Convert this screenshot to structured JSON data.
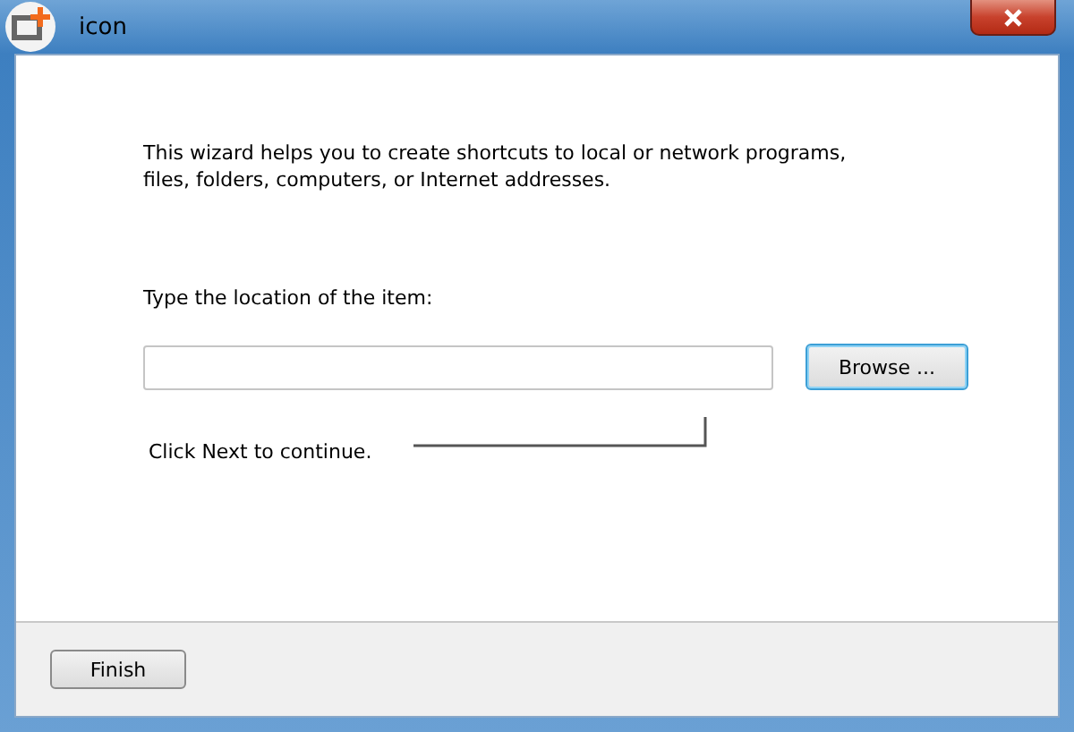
{
  "window": {
    "title": "icon"
  },
  "intro": "This wizard helps you to create shortcuts to local or network programs, files, folders, computers, or Internet addresses.",
  "location": {
    "label": "Type the location of the item:",
    "browse": "Browse ..."
  },
  "hint": "Click Next to continue.",
  "buttons": [
    "Finish"
  ]
}
